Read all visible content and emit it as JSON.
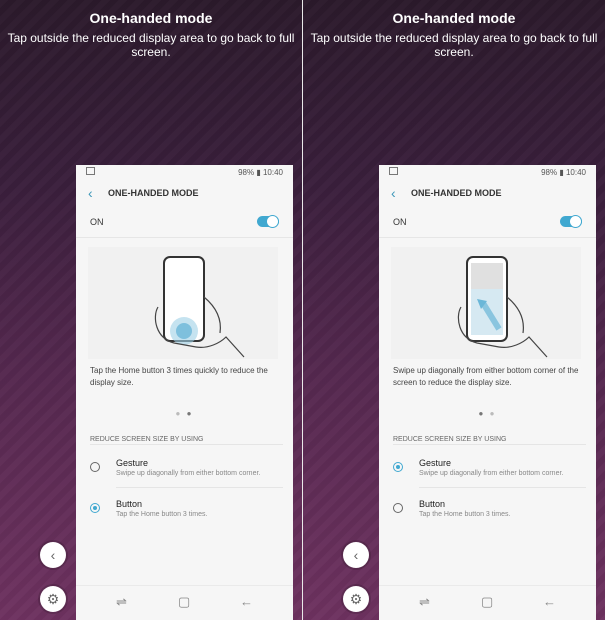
{
  "panels": [
    {
      "headline": "One-handed mode",
      "subtext": "Tap outside the reduced display area to go back to full screen.",
      "status": "98% ▮ 10:40",
      "screen_title": "ONE-HANDED MODE",
      "on_label": "ON",
      "description": "Tap the Home button 3 times quickly to reduce the display size.",
      "section_header": "REDUCE SCREEN SIZE BY USING",
      "options": [
        {
          "title": "Gesture",
          "subtitle": "Swipe up diagonally from either bottom corner.",
          "selected": false
        },
        {
          "title": "Button",
          "subtitle": "Tap the Home button 3 times.",
          "selected": true
        }
      ]
    },
    {
      "headline": "One-handed mode",
      "subtext": "Tap outside the reduced display area to go back to full screen.",
      "status": "98% ▮ 10:40",
      "screen_title": "ONE-HANDED MODE",
      "on_label": "ON",
      "description": "Swipe up diagonally from either bottom corner of the screen to reduce the display size.",
      "section_header": "REDUCE SCREEN SIZE BY USING",
      "options": [
        {
          "title": "Gesture",
          "subtitle": "Swipe up diagonally from either bottom corner.",
          "selected": true
        },
        {
          "title": "Button",
          "subtitle": "Tap the Home button 3 times.",
          "selected": false
        }
      ]
    }
  ],
  "icons": {
    "back": "chevron-left-icon",
    "settings": "gear-icon",
    "recent": "recent-apps-icon",
    "home": "home-icon",
    "nav_back": "back-arrow-icon"
  },
  "colors": {
    "accent": "#40a8d0",
    "bg_top": "#2b1a2b",
    "bg_bottom": "#6e3260"
  }
}
